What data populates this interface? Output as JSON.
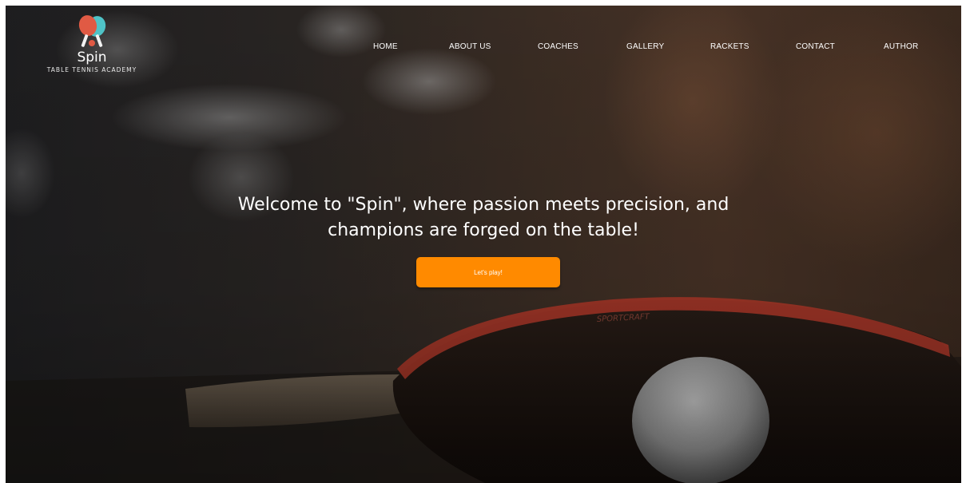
{
  "brand": {
    "name": "Spin",
    "tagline": "TABLE TENNIS ACADEMY"
  },
  "nav": {
    "items": [
      {
        "label": "HOME"
      },
      {
        "label": "ABOUT US"
      },
      {
        "label": "COACHES"
      },
      {
        "label": "GALLERY"
      },
      {
        "label": "RACKETS"
      },
      {
        "label": "CONTACT"
      },
      {
        "label": "AUTHOR"
      }
    ]
  },
  "hero": {
    "headline": "Welcome to \"Spin\", where passion meets precision, and champions are forged on the table!",
    "cta_label": "Let's play!",
    "racket_print": "SPORTCRAFT"
  },
  "colors": {
    "accent": "#ff8a00",
    "racket_red": "#c0392b",
    "racket_teal": "#4fc3c7",
    "text": "#ffffff"
  }
}
